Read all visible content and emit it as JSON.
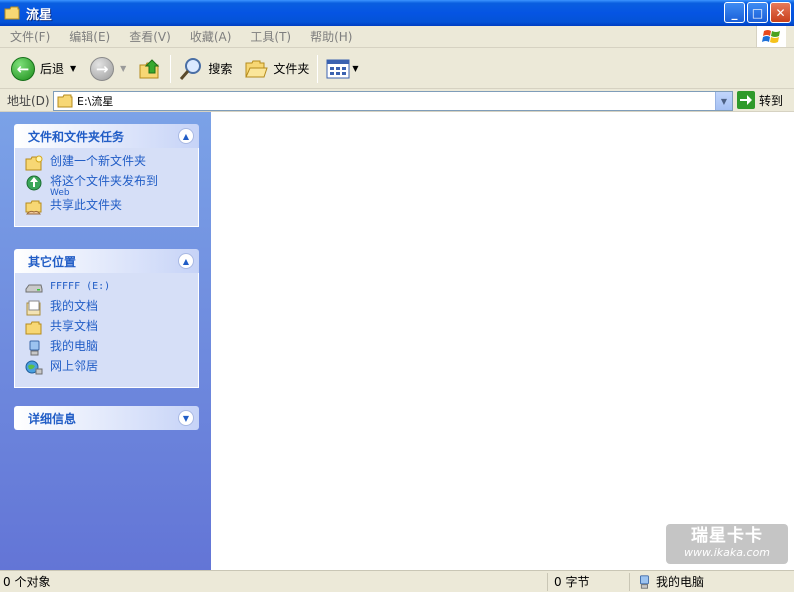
{
  "window": {
    "title": "流星",
    "minimize_glyph": "_",
    "maximize_glyph": "□",
    "close_glyph": "✕"
  },
  "menu": [
    "文件(F)",
    "编辑(E)",
    "查看(V)",
    "收藏(A)",
    "工具(T)",
    "帮助(H)"
  ],
  "toolbar": {
    "back_label": "后退",
    "search_label": "搜索",
    "folders_label": "文件夹"
  },
  "address": {
    "label": "地址(D)",
    "value": "E:\\流星",
    "go_label": "转到"
  },
  "task_pane": {
    "file_tasks": {
      "title": "文件和文件夹任务",
      "items": [
        {
          "label": "创建一个新文件夹",
          "icon": "new-folder-icon"
        },
        {
          "label": "将这个文件夹发布到",
          "sub": "Web",
          "icon": "publish-web-icon"
        },
        {
          "label": "共享此文件夹",
          "icon": "share-folder-icon"
        }
      ]
    },
    "other_places": {
      "title": "其它位置",
      "items": [
        {
          "label": "FFFFF (E:)",
          "icon": "drive-icon"
        },
        {
          "label": "我的文档",
          "icon": "my-documents-icon"
        },
        {
          "label": "共享文档",
          "icon": "shared-documents-icon"
        },
        {
          "label": "我的电脑",
          "icon": "my-computer-icon"
        },
        {
          "label": "网上邻居",
          "icon": "network-places-icon"
        }
      ]
    },
    "details": {
      "title": "详细信息"
    }
  },
  "watermark": {
    "line1": "瑞星卡卡",
    "line2": "www.ikaka.com"
  },
  "status": {
    "objects": "0 个对象",
    "size": "0 字节",
    "location": "我的电脑"
  }
}
